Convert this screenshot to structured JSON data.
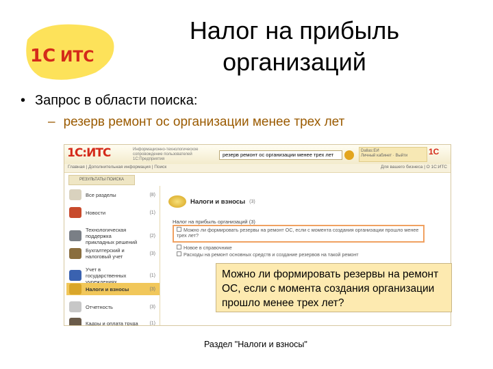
{
  "slide": {
    "title_line1": "Налог на прибыль",
    "title_line2": "организаций",
    "bullet": "Запрос в области поиска:",
    "bullet_marker": "•",
    "sub_marker": "–",
    "sub_bullet": "резерв ремонт ос организации менее трех лет",
    "logo_text": "1С:ИТС"
  },
  "screenshot": {
    "logo": "1С:ИТС",
    "description": "Информационно-технологическое сопровождение пользователей 1С:Предприятия",
    "search_value": "резерв ремонт ос организации менее трех лет",
    "user": "Dallas:ЕИ",
    "user_sub": "Личный кабинет · Выйти",
    "right_logo": "1С",
    "nav_left": "Главная | Дополнительная информация | Поиск",
    "nav_right": "Для вашего бизнеса | О 1С:ИТС",
    "results_tab": "РЕЗУЛЬТАТЫ ПОИСКА",
    "sidebar": [
      {
        "label": "Все разделы",
        "count": "(8)",
        "icon": "magnifier-icon",
        "color": "#d9d2be"
      },
      {
        "label": "Новости",
        "count": "(1)",
        "icon": "news-icon",
        "color": "#c84a2c"
      },
      {
        "label": "Технологическая поддержка прикладных решений",
        "count": "(2)",
        "icon": "support-icon",
        "color": "#7a7f86"
      },
      {
        "label": "Бухгалтерский и налоговый учет",
        "count": "(3)",
        "icon": "accounting-icon",
        "color": "#8a6e3e"
      },
      {
        "label": "Учет в государственных учреждениях",
        "count": "(1)",
        "icon": "flag-icon",
        "color": "#3a62b0"
      },
      {
        "label": "Налоги и взносы",
        "count": "(3)",
        "icon": "coins-icon",
        "color": "#d9a62a"
      },
      {
        "label": "Отчетность",
        "count": "(3)",
        "icon": "report-icon",
        "color": "#c7c7c7"
      },
      {
        "label": "Кадры и оплата труда",
        "count": "(1)",
        "icon": "people-icon",
        "color": "#6a5b4a"
      }
    ],
    "content_title": "Налоги и взносы",
    "content_count": "(3)",
    "tree_head": "Налог на прибыль организаций (3)",
    "tree_items": [
      "Можно ли формировать резервы на ремонт ОС, если с момента создания организации прошло менее трех лет?",
      "Новое в справочнике",
      "Расходы на ремонт основных средств и создание резервов на такой ремонт"
    ]
  },
  "callout": "Можно ли формировать резервы на ремонт ОС, если с момента создания организации прошло менее трех лет?",
  "caption": "Раздел \"Налоги и взносы\""
}
